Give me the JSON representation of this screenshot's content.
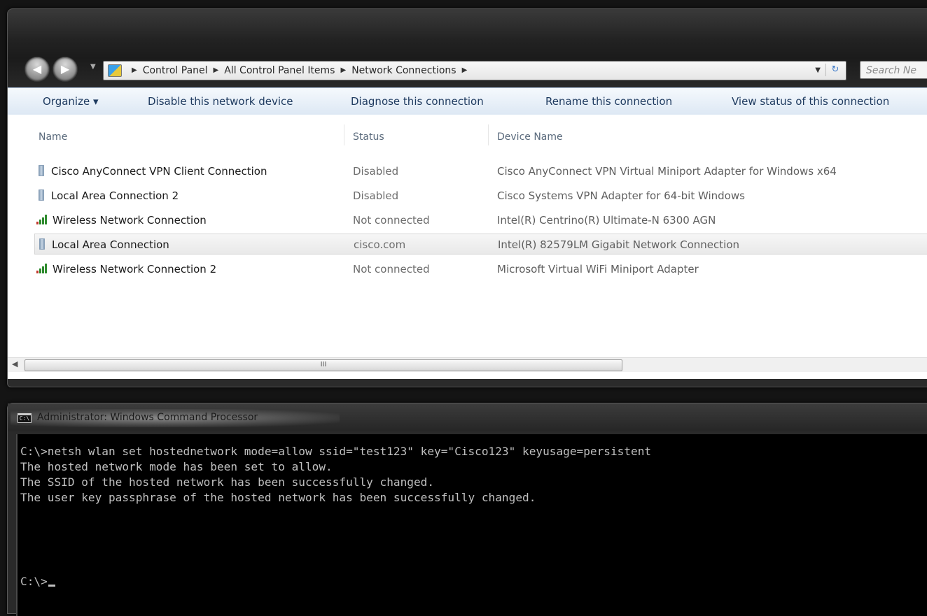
{
  "explorer": {
    "breadcrumb": [
      "Control Panel",
      "All Control Panel Items",
      "Network Connections"
    ],
    "search_placeholder": "Search Ne",
    "toolbar": {
      "organize": "Organize ▾",
      "disable": "Disable this network device",
      "diagnose": "Diagnose this connection",
      "rename": "Rename this connection",
      "view_status": "View status of this connection"
    },
    "columns": {
      "name": "Name",
      "status": "Status",
      "device": "Device Name"
    },
    "rows": [
      {
        "name": "Cisco AnyConnect VPN Client Connection",
        "status": "Disabled",
        "device": "Cisco AnyConnect VPN Virtual Miniport Adapter for Windows x64",
        "icon": "wired-adapter-icon",
        "selected": false
      },
      {
        "name": "Local Area Connection 2",
        "status": "Disabled",
        "device": "Cisco Systems VPN Adapter for 64-bit Windows",
        "icon": "wired-adapter-icon",
        "selected": false
      },
      {
        "name": "Wireless Network Connection",
        "status": "Not connected",
        "device": "Intel(R) Centrino(R) Ultimate-N 6300 AGN",
        "icon": "wireless-signal-icon",
        "selected": false
      },
      {
        "name": "Local Area Connection",
        "status": "cisco.com",
        "device": "Intel(R) 82579LM Gigabit Network Connection",
        "icon": "wired-adapter-icon",
        "selected": true
      },
      {
        "name": "Wireless Network Connection 2",
        "status": "Not connected",
        "device": "Microsoft Virtual WiFi Miniport Adapter",
        "icon": "wireless-signal-icon",
        "selected": false
      }
    ],
    "scrollbar_grip": "III"
  },
  "cmd": {
    "title": "Administrator: Windows Command Processor",
    "icon_text": "C:\\",
    "lines": [
      "C:\\>netsh wlan set hostednetwork mode=allow ssid=\"test123\" key=\"Cisco123\" keyusage=persistent",
      "The hosted network mode has been set to allow.",
      "The SSID of the hosted network has been successfully changed.",
      "The user key passphrase of the hosted network has been successfully changed.",
      "",
      "",
      "C:\\>"
    ]
  },
  "colors": {
    "toolbar_text": "#1e3a5f",
    "console_text": "#c0c0c0",
    "console_bg": "#000000"
  }
}
